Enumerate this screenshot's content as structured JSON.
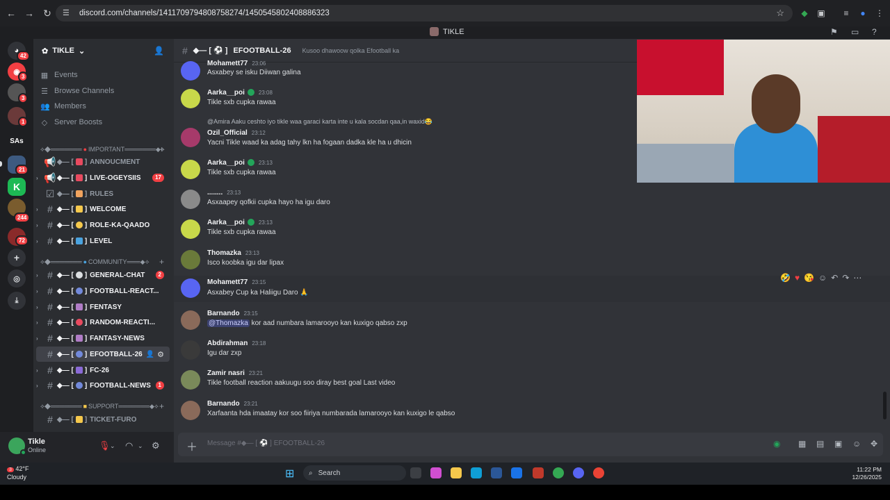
{
  "browser": {
    "url": "discord.com/channels/1411709794808758274/1450545802408886323"
  },
  "titlebar": {
    "server": "TIKLE"
  },
  "rail": {
    "badges": [
      "42",
      "3",
      "1",
      "21",
      "244",
      "72"
    ],
    "text_server": "SAs"
  },
  "sidebar": {
    "guild_name": "TIKLE",
    "nav": [
      "Events",
      "Browse Channels",
      "Members",
      "Server Boosts"
    ],
    "categories": {
      "important": "IMPORTANT",
      "community": "COMMUNITY",
      "support": "SUPPORT"
    },
    "channels": [
      {
        "name": "ANNOUCMENT",
        "count": ""
      },
      {
        "name": "LIVE-OGEYSIIS",
        "count": "17"
      },
      {
        "name": "RULES",
        "count": ""
      },
      {
        "name": "WELCOME",
        "count": ""
      },
      {
        "name": "ROLE-KA-QAADO",
        "count": ""
      },
      {
        "name": "LEVEL",
        "count": ""
      },
      {
        "name": "GENERAL-CHAT",
        "count": "2"
      },
      {
        "name": "FOOTBALL-REACT...",
        "count": ""
      },
      {
        "name": "FENTASY",
        "count": ""
      },
      {
        "name": "RANDOM-REACTI...",
        "count": ""
      },
      {
        "name": "FANTASY-NEWS",
        "count": ""
      },
      {
        "name": "EFOOTBALL-26",
        "count": ""
      },
      {
        "name": "FC-26",
        "count": ""
      },
      {
        "name": "FOOTBALL-NEWS",
        "count": "1"
      },
      {
        "name": "TICKET-FURO",
        "count": ""
      }
    ]
  },
  "user": {
    "name": "Tikle",
    "status": "Online"
  },
  "channel_header": {
    "name": "EFOOTBALL-26",
    "topic": "Kusoo dhawoow qolka Efootball ka"
  },
  "messages": [
    {
      "author": "Mohamett77",
      "time": "23:06",
      "text": "Asxabey se isku Diiwan galina"
    },
    {
      "author": "Aarka__poi",
      "time": "23:08",
      "text": "Tikle sxb cupka rawaa"
    },
    {
      "reply": "@Amira Aaku ceshto iyo tikle waa garaci karta inte u kala socdan qaa,in waxid😂",
      "author": "Ozil_Official",
      "time": "23:12",
      "text": "Yacni Tikle waad ka adag tahy lkn ha fogaan dadka kle ha u dhicin"
    },
    {
      "author": "Aarka__poi",
      "time": "23:13",
      "text": "Tikle sxb cupka rawaa"
    },
    {
      "author": "........",
      "time": "23:13",
      "text": "Asxaapey qofkii cupka hayo ha igu daro"
    },
    {
      "author": "Aarka__poi",
      "time": "23:13",
      "text": "Tikle sxb cupka rawaa"
    },
    {
      "author": "Thomazka",
      "time": "23:13",
      "text": "Isco koobka igu dar lipax"
    },
    {
      "author": "Mohamett77",
      "time": "23:15",
      "text": "Asxabey Cup ka Haliigu Daro 🙏"
    },
    {
      "author": "Barnando",
      "time": "23:15",
      "mention": "@Thomazka",
      "text": " kor aad numbara lamarooyo kan kuxigo qabso zxp"
    },
    {
      "author": "Abdirahman",
      "time": "23:18",
      "text": "Igu dar zxp"
    },
    {
      "author": "Zamir nasri",
      "time": "23:21",
      "text": "Tikle football reaction aakuugu soo diray best goal Last video"
    },
    {
      "author": "Barnando",
      "time": "23:21",
      "text": "Xarfaanta hda imaatay kor soo fiiriya numbarada lamarooyo kan kuxigo le qabso"
    }
  ],
  "composer": {
    "placeholder": "Message #◆— [ ⚽ ] EFOOTBALL-26"
  },
  "taskbar": {
    "weather_temp": "42°F",
    "weather_desc": "Cloudy",
    "weather_badge": "3",
    "search": "Search",
    "time": "11:22 PM",
    "date": "12/26/2025"
  },
  "colors": {
    "accent": "#5865f2",
    "unread_badge": "#f23f43",
    "online": "#23a55a",
    "bg_main": "#313338",
    "bg_sidebar": "#2b2d31"
  }
}
